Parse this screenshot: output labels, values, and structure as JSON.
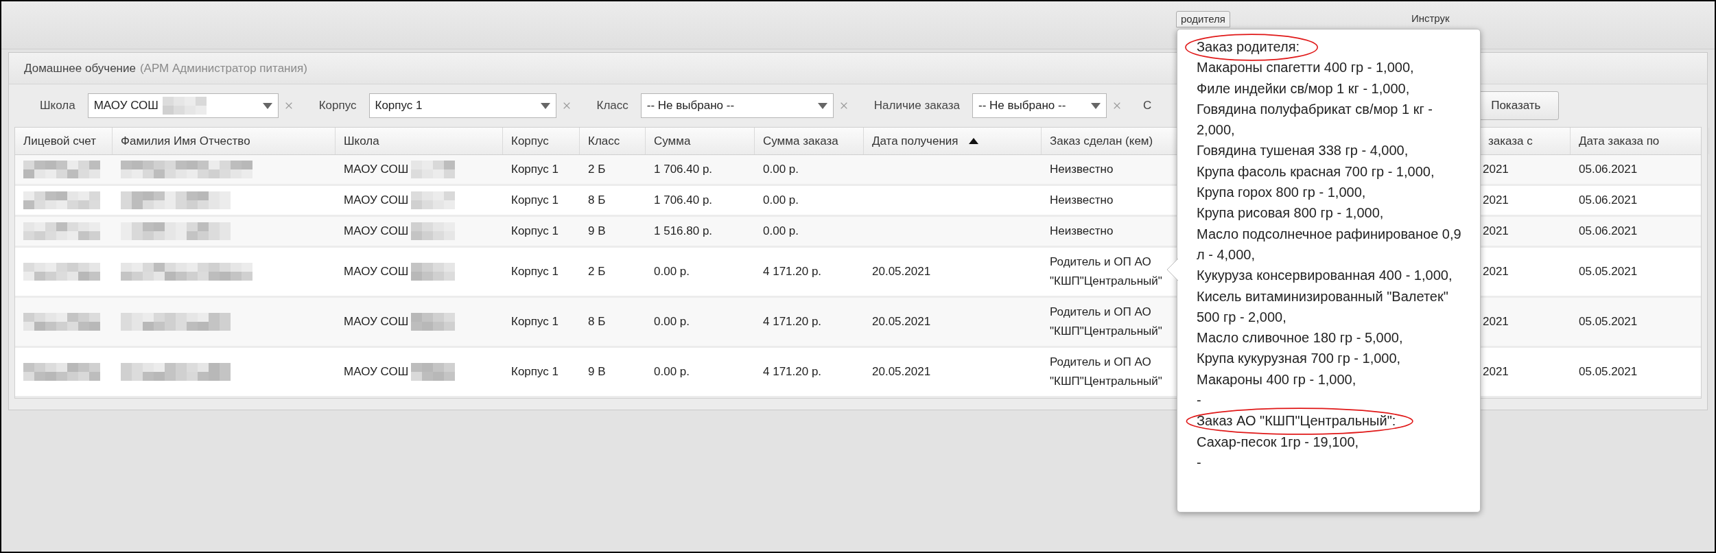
{
  "top_tabs": [
    {
      "label": "родителя"
    },
    {
      "label": "Инструк"
    }
  ],
  "panel": {
    "title": "Домашнее обучение",
    "subtitle": "(АРМ Администратор питания)"
  },
  "filters": [
    {
      "label": "Школа",
      "value": "МАОУ СОШ",
      "blurred": true
    },
    {
      "label": "Корпус",
      "value": "Корпус 1",
      "blurred": false
    },
    {
      "label": "Класс",
      "value": "-- Не выбрано --",
      "blurred": false
    },
    {
      "label": "Наличие заказа",
      "value": "-- Не выбрано --",
      "blurred": false
    }
  ],
  "date_from": {
    "label": "С"
  },
  "show_button": "Показать",
  "columns": [
    {
      "label": "Лицевой счет"
    },
    {
      "label": "Фамилия Имя Отчество"
    },
    {
      "label": "Школа"
    },
    {
      "label": "Корпус"
    },
    {
      "label": "Класс"
    },
    {
      "label": "Сумма"
    },
    {
      "label": "Сумма заказа"
    },
    {
      "label": "Дата получения",
      "sorted_ascending": true
    },
    {
      "label": "Заказ сделан (кем)"
    },
    {
      "label": "заказа с"
    },
    {
      "label": "Дата заказа по"
    }
  ],
  "rows": [
    {
      "school": "МАОУ СОШ",
      "building": "Корпус 1",
      "class": "2 Б",
      "sum": "1 706.40 р.",
      "order_sum": "0.00 р.",
      "ordered_by": "Неизвестно",
      "from": "2021",
      "to": "05.06.2021"
    },
    {
      "school": "МАОУ СОШ",
      "building": "Корпус 1",
      "class": "8 Б",
      "sum": "1 706.40 р.",
      "order_sum": "0.00 р.",
      "ordered_by": "Неизвестно",
      "from": "2021",
      "to": "05.06.2021"
    },
    {
      "school": "МАОУ СОШ",
      "building": "Корпус 1",
      "class": "9 В",
      "sum": "1 516.80 р.",
      "order_sum": "0.00 р.",
      "ordered_by": "Неизвестно",
      "from": "2021",
      "to": "05.06.2021"
    },
    {
      "school": "МАОУ СОШ",
      "building": "Корпус 1",
      "class": "2 Б",
      "sum": "0.00 р.",
      "order_sum": "4 171.20 р.",
      "received": "20.05.2021",
      "ordered_by": "Родитель и ОП АО \"КШП\"Центральный\"",
      "from": "2021",
      "to": "05.05.2021"
    },
    {
      "school": "МАОУ СОШ",
      "building": "Корпус 1",
      "class": "8 Б",
      "sum": "0.00 р.",
      "order_sum": "4 171.20 р.",
      "received": "20.05.2021",
      "ordered_by": "Родитель и ОП АО \"КШП\"Центральный\"",
      "from": "2021",
      "to": "05.05.2021"
    },
    {
      "school": "МАОУ СОШ",
      "building": "Корпус 1",
      "class": "9 В",
      "sum": "0.00 р.",
      "order_sum": "4 171.20 р.",
      "received": "20.05.2021",
      "ordered_by": "Родитель и ОП АО \"КШП\"Центральный\"",
      "from": "2021",
      "to": "05.05.2021"
    }
  ],
  "tooltip": {
    "lines": [
      {
        "kind": "heading",
        "text": "Заказ родителя:"
      },
      {
        "kind": "item",
        "text": "Макароны спагетти 400 гр - 1,000,"
      },
      {
        "kind": "item",
        "text": "Филе индейки св/мор 1 кг - 1,000,"
      },
      {
        "kind": "item",
        "text": "Говядина полуфабрикат св/мор 1 кг - 2,000,"
      },
      {
        "kind": "item",
        "text": "Говядина тушеная 338 гр - 4,000,"
      },
      {
        "kind": "item",
        "text": "Крупа фасоль красная 700 гр - 1,000,"
      },
      {
        "kind": "item",
        "text": "Крупа горох 800 гр - 1,000,"
      },
      {
        "kind": "item",
        "text": "Крупа рисовая 800 гр - 1,000,"
      },
      {
        "kind": "item",
        "text": "Масло подсолнечное рафинированое 0,9 л - 4,000,"
      },
      {
        "kind": "item",
        "text": "Кукуруза консервированная 400 - 1,000,"
      },
      {
        "kind": "item",
        "text": "Кисель витаминизированный \"Валетек\" 500 гр - 2,000,"
      },
      {
        "kind": "item",
        "text": "Масло сливочное 180 гр - 5,000,"
      },
      {
        "kind": "item",
        "text": "Крупа кукурузная 700 гр - 1,000,"
      },
      {
        "kind": "item",
        "text": "Макароны 400 гр - 1,000,"
      },
      {
        "kind": "item",
        "text": "-"
      },
      {
        "kind": "heading",
        "text": "Заказ АО \"КШП\"Центральный\":"
      },
      {
        "kind": "item",
        "text": "Сахар-песок 1гр - 19,100,"
      },
      {
        "kind": "item",
        "text": "-"
      }
    ]
  }
}
